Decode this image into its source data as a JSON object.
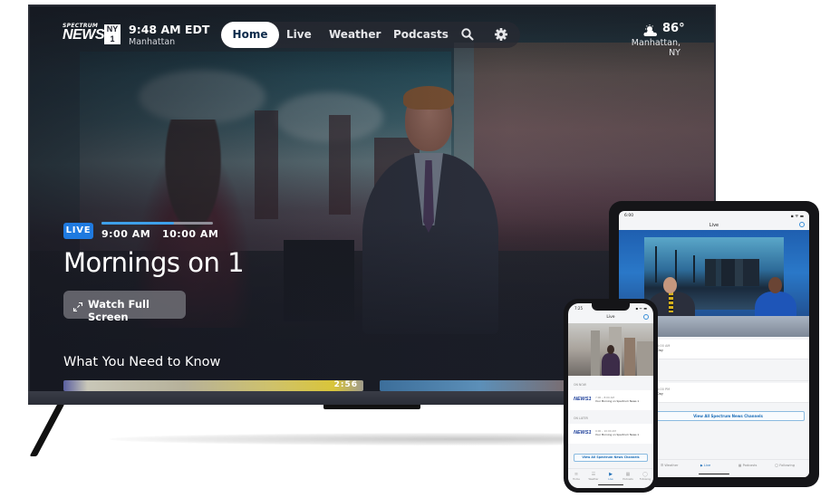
{
  "tv": {
    "logo": {
      "top": "SPECTRUM",
      "main": "NEWS",
      "badge": "NY 1"
    },
    "clock": {
      "time": "9:48 AM EDT",
      "location": "Manhattan"
    },
    "nav": {
      "items": [
        {
          "label": "Home",
          "active": true
        },
        {
          "label": "Live",
          "active": false
        },
        {
          "label": "Weather",
          "active": false
        },
        {
          "label": "Podcasts",
          "active": false
        }
      ],
      "search_icon": "search-icon",
      "settings_icon": "gear-icon"
    },
    "weather": {
      "icon": "partly-sunny-icon",
      "temp": "86°",
      "location": "Manhattan, NY"
    },
    "program": {
      "badge": "LIVE",
      "start": "9:00 AM",
      "end": "10:00 AM",
      "progress_percent": 65,
      "title": "Mornings on 1",
      "watch_button": "Watch Full Screen"
    },
    "section": {
      "title": "What You Need to Know",
      "cards": [
        {
          "duration": "2:56"
        },
        {
          "duration": ""
        }
      ]
    },
    "colors": {
      "live_badge": "#1f7ae0",
      "progress": "#3ea0ea",
      "nav_active_text": "#0b2a4a"
    }
  },
  "ipad": {
    "status_time": "6:00",
    "status_icons": "▪ ᯤ ▬",
    "title": "Live",
    "rows": [
      {
        "time": "6:00 AM",
        "subtitle": "Day"
      },
      {
        "time": "",
        "subtitle": ""
      },
      {
        "time": "5:00 PM",
        "subtitle": "Day"
      }
    ],
    "view_all": "View All Spectrum News Channels",
    "tabs": [
      {
        "icon": "☰",
        "label": "Weather",
        "active": false
      },
      {
        "icon": "▶",
        "label": "Live",
        "active": true
      },
      {
        "icon": "▦",
        "label": "Podcasts",
        "active": false
      },
      {
        "icon": "◯",
        "label": "Following",
        "active": false
      }
    ]
  },
  "iphone": {
    "status_time": "7:25",
    "status_icons": "▪ ᯤ ▬",
    "title": "Live",
    "groups": [
      {
        "header": "ON NOW",
        "logo": "NEWS1",
        "time": "7:00 – 8:00 AM",
        "subtitle": "Your Morning on Spectrum News 1"
      },
      {
        "header": "ON LATER",
        "logo": "NEWS1",
        "time": "9:00 – 10:00 AM",
        "subtitle": "Your Morning on Spectrum News 1"
      }
    ],
    "view_all": "View All Spectrum News Channels",
    "tabs": [
      {
        "icon": "≡",
        "label": "Home",
        "active": false
      },
      {
        "icon": "☰",
        "label": "Weather",
        "active": false
      },
      {
        "icon": "▶",
        "label": "Live",
        "active": true
      },
      {
        "icon": "▦",
        "label": "Podcasts",
        "active": false
      },
      {
        "icon": "◯",
        "label": "Following",
        "active": false
      }
    ]
  }
}
